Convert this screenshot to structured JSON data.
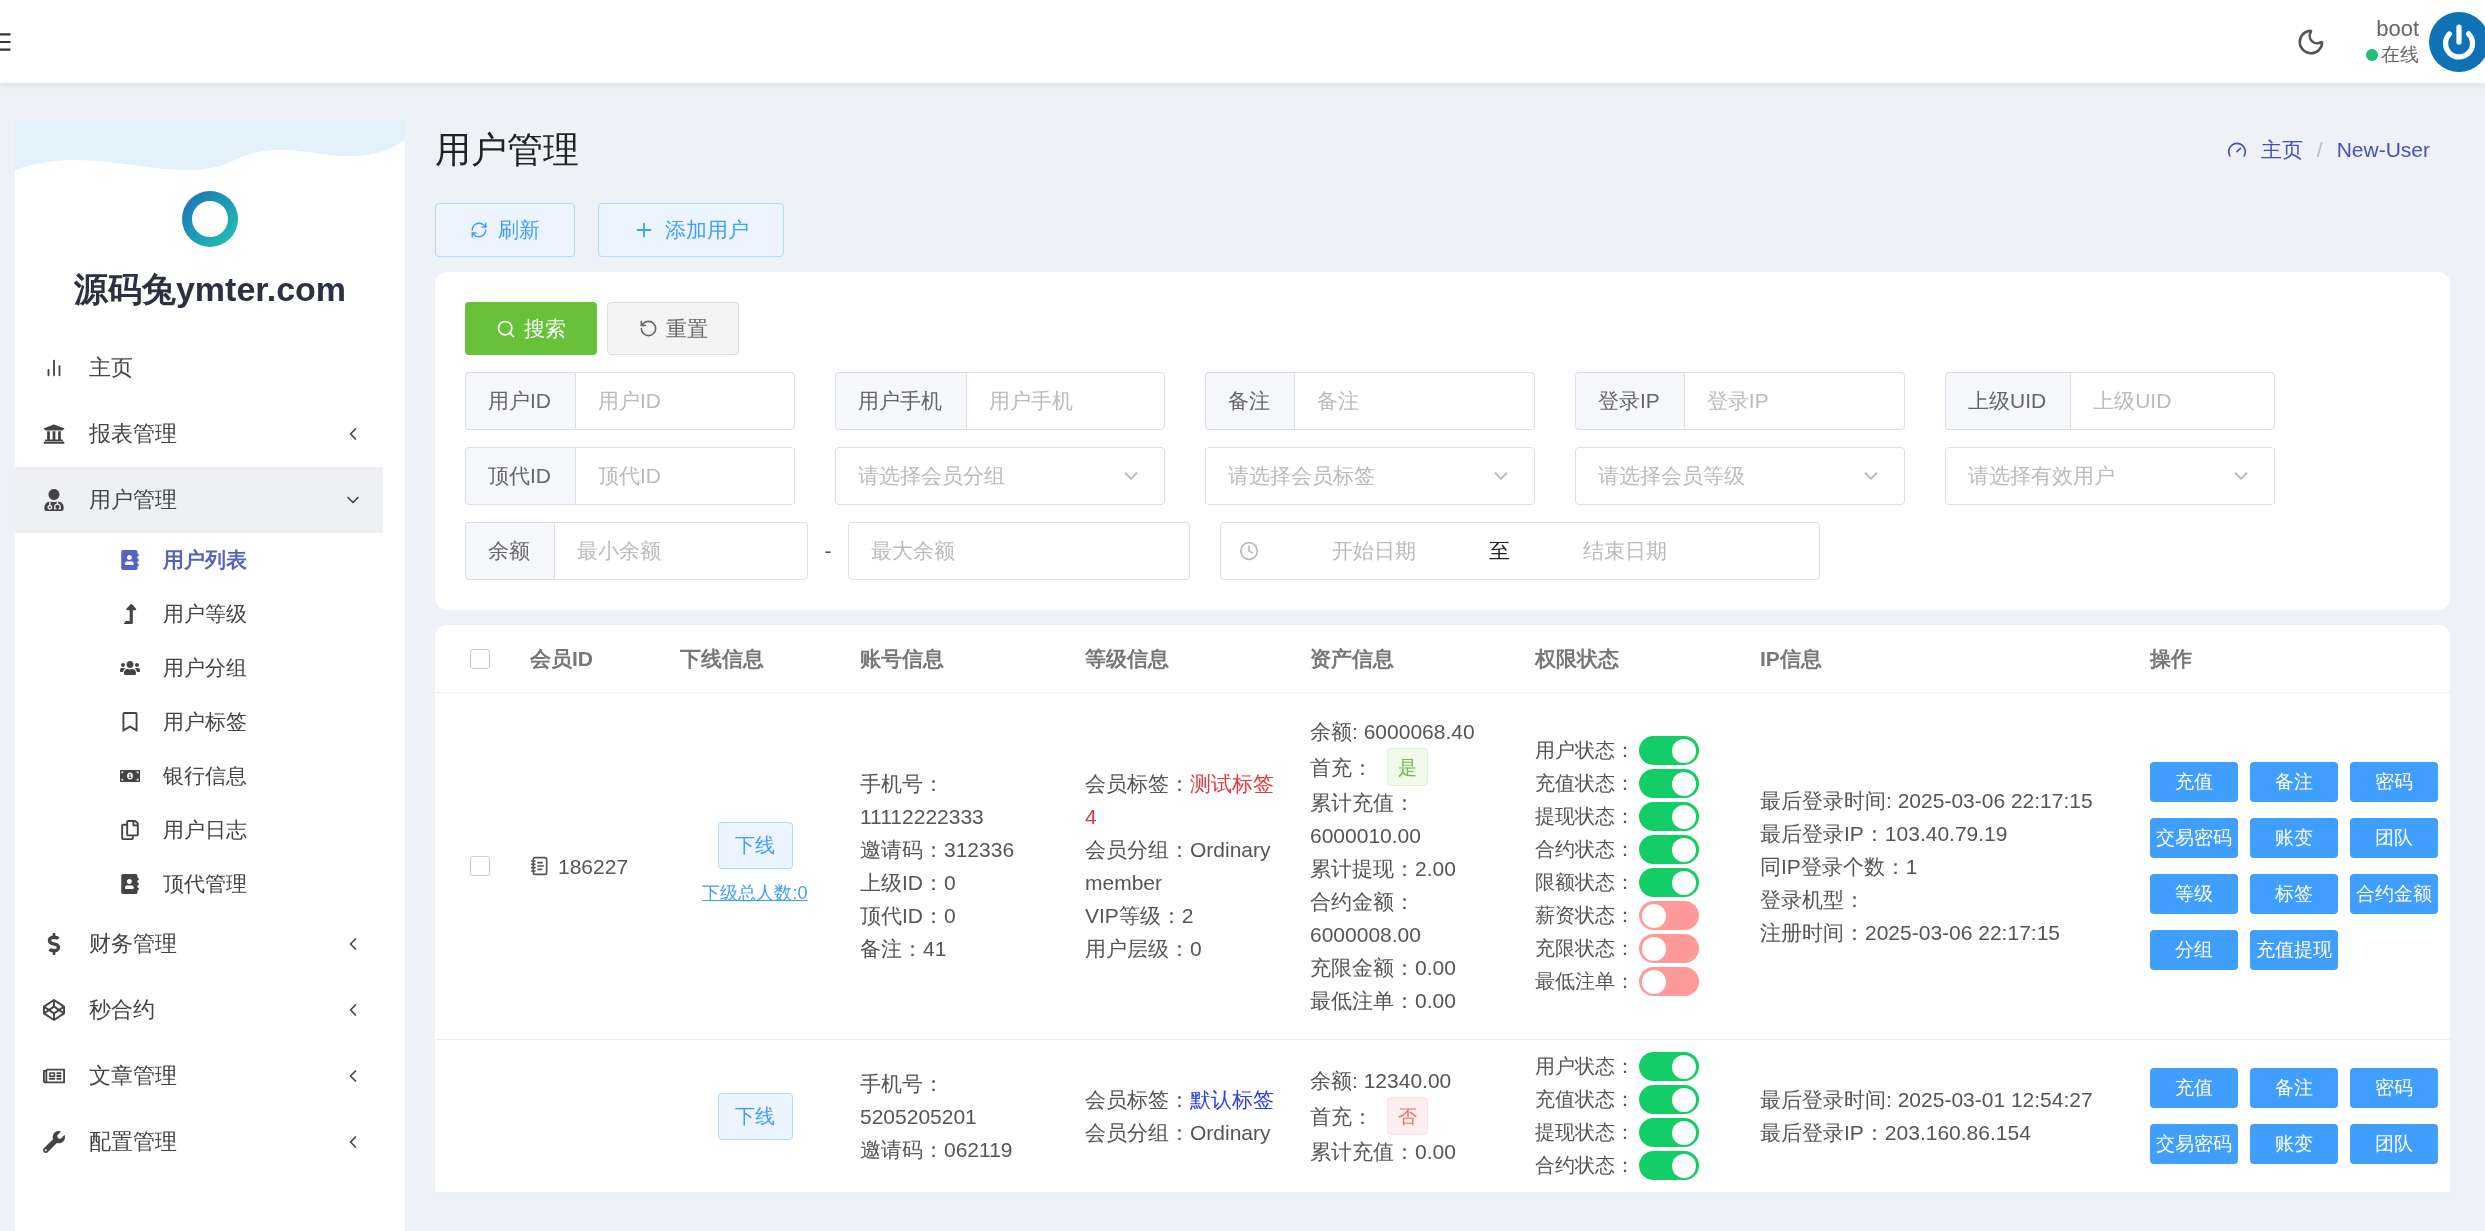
{
  "header": {
    "user": "boot",
    "status": "在线"
  },
  "sidebar": {
    "brand": "源码兔ymter.com",
    "items": [
      {
        "label": "主页",
        "kind": "link",
        "selected": false
      },
      {
        "label": "报表管理",
        "kind": "group",
        "expanded": false,
        "selected": false
      },
      {
        "label": "用户管理",
        "kind": "group",
        "expanded": true,
        "selected": true,
        "children": [
          {
            "label": "用户列表",
            "selected": true
          },
          {
            "label": "用户等级",
            "selected": false
          },
          {
            "label": "用户分组",
            "selected": false
          },
          {
            "label": "用户标签",
            "selected": false
          },
          {
            "label": "银行信息",
            "selected": false
          },
          {
            "label": "用户日志",
            "selected": false
          },
          {
            "label": "顶代管理",
            "selected": false
          }
        ]
      },
      {
        "label": "财务管理",
        "kind": "group",
        "expanded": false,
        "selected": false
      },
      {
        "label": "秒合约",
        "kind": "group",
        "expanded": false,
        "selected": false
      },
      {
        "label": "文章管理",
        "kind": "group",
        "expanded": false,
        "selected": false
      },
      {
        "label": "配置管理",
        "kind": "group",
        "expanded": false,
        "selected": false
      }
    ]
  },
  "page": {
    "title": "用户管理",
    "breadcrumb": [
      "主页",
      "New-User"
    ],
    "breadcrumb_separator": "/",
    "toolbar": [
      "刷新",
      "添加用户"
    ]
  },
  "filters": {
    "search": "搜索",
    "reset": "重置",
    "fields": [
      {
        "kind": "text",
        "label": "用户ID",
        "placeholder": "用户ID"
      },
      {
        "kind": "text",
        "label": "用户手机",
        "placeholder": "用户手机"
      },
      {
        "kind": "text",
        "label": "备注",
        "placeholder": "备注"
      },
      {
        "kind": "text",
        "label": "登录IP",
        "placeholder": "登录IP"
      },
      {
        "kind": "text",
        "label": "上级UID",
        "placeholder": "上级UID"
      },
      {
        "kind": "text",
        "label": "顶代ID",
        "placeholder": "顶代ID"
      },
      {
        "kind": "select",
        "placeholder": "请选择会员分组"
      },
      {
        "kind": "select",
        "placeholder": "请选择会员标签"
      },
      {
        "kind": "select",
        "placeholder": "请选择会员等级"
      },
      {
        "kind": "select",
        "placeholder": "请选择有效用户"
      }
    ],
    "balance": {
      "label": "余额",
      "min_placeholder": "最小余额",
      "separator": "-",
      "max_placeholder": "最大余额"
    },
    "dates": {
      "start_placeholder": "开始日期",
      "separator": "至",
      "end_placeholder": "结束日期"
    }
  },
  "table": {
    "all_selected": false,
    "columns": [
      "会员ID",
      "下线信息",
      "账号信息",
      "等级信息",
      "资产信息",
      "权限状态",
      "IP信息",
      "操作"
    ],
    "rows": [
      {
        "selected": false,
        "id": "186227",
        "downline": "下线",
        "downline_count": "下级总人数:0",
        "account": [
          "手机号：11112222333",
          "邀请码：312336",
          "上级ID：0",
          "顶代ID：0",
          "备注：41"
        ],
        "grade": {
          "tag_label": "会员标签：",
          "tag": {
            "text": "测试标签4",
            "color": "#e0393e"
          },
          "lines": [
            "会员分组：Ordinary member",
            "VIP等级：2",
            "用户层级：0"
          ]
        },
        "asset": {
          "balance": "余额: 6000068.40",
          "first_charge": {
            "label": "首充：",
            "value": "是",
            "kind": "yes"
          },
          "lines": [
            "累计充值：6000010.00",
            "累计提现：2.00",
            "合约金额：6000008.00",
            "充限金额：0.00",
            "最低注单：0.00"
          ]
        },
        "permissions": [
          {
            "label": "用户状态：",
            "on": true
          },
          {
            "label": "充值状态：",
            "on": true
          },
          {
            "label": "提现状态：",
            "on": true
          },
          {
            "label": "合约状态：",
            "on": true
          },
          {
            "label": "限额状态：",
            "on": true
          },
          {
            "label": "薪资状态：",
            "on": false
          },
          {
            "label": "充限状态：",
            "on": false
          },
          {
            "label": "最低注单：",
            "on": false
          }
        ],
        "ip": [
          "最后登录时间: 2025-03-06 22:17:15",
          "最后登录IP：103.40.79.19",
          "同IP登录个数：1",
          "登录机型：",
          "注册时间：2025-03-06 22:17:15"
        ],
        "actions": [
          "充值",
          "备注",
          "密码",
          "交易密码",
          "账变",
          "团队",
          "等级",
          "标签",
          "合约金额",
          "分组",
          "充值提现"
        ]
      },
      {
        "downline": "下线",
        "account": [
          "手机号：5205205201",
          "邀请码：062119"
        ],
        "grade": {
          "tag_label": "会员标签：",
          "tag": {
            "text": "默认标签",
            "color": "#2c3ee8"
          },
          "lines": [
            "会员分组：Ordinary"
          ]
        },
        "asset": {
          "balance": "余额: 12340.00",
          "first_charge": {
            "label": "首充：",
            "value": "否",
            "kind": "no"
          },
          "lines": [
            "累计充值：0.00"
          ]
        },
        "permissions": [
          {
            "label": "用户状态：",
            "on": true
          },
          {
            "label": "充值状态：",
            "on": true
          },
          {
            "label": "提现状态：",
            "on": true
          },
          {
            "label": "合约状态：",
            "on": true
          }
        ],
        "ip": [
          "最后登录时间: 2025-03-01 12:54:27",
          "最后登录IP：203.160.86.154"
        ],
        "actions": [
          "充值",
          "备注",
          "密码",
          "交易密码",
          "账变",
          "团队"
        ]
      }
    ]
  }
}
